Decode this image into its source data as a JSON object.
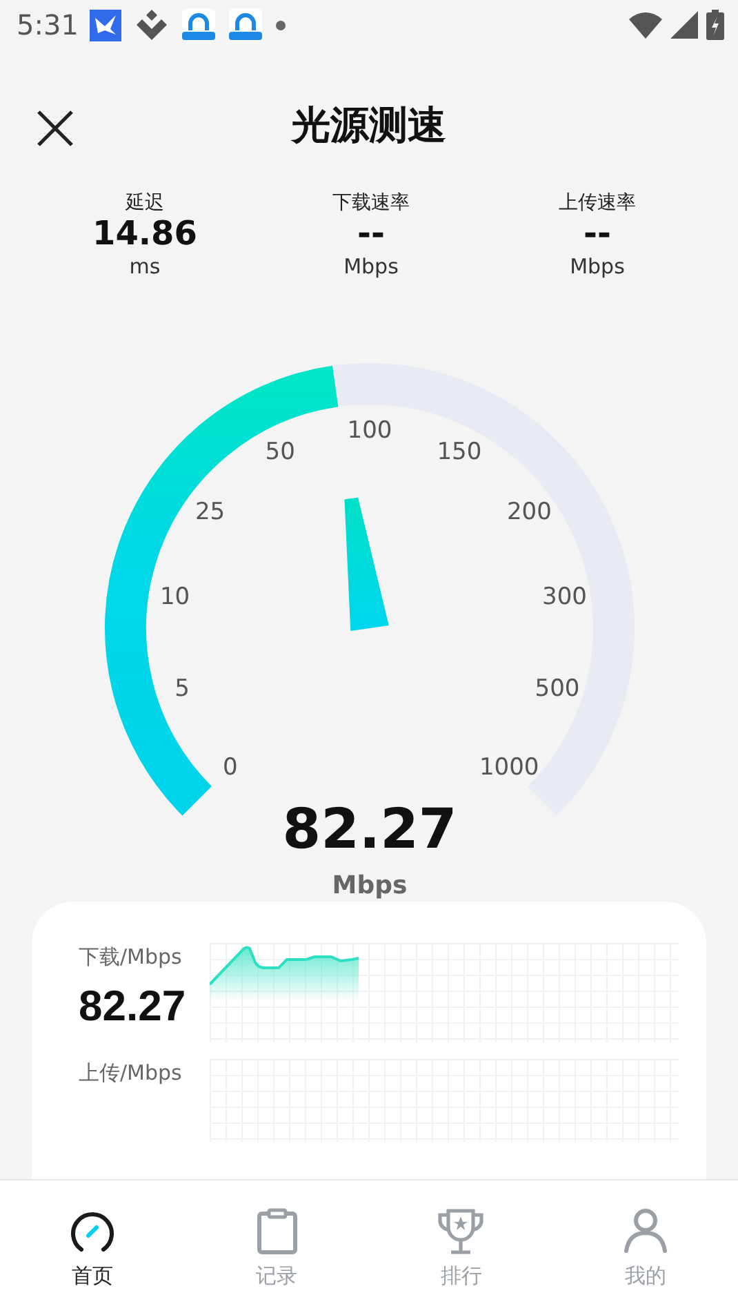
{
  "status_bar": {
    "time": "5:31"
  },
  "header": {
    "title": "光源测速"
  },
  "stats": [
    {
      "label": "延迟",
      "value": "14.86",
      "unit": "ms"
    },
    {
      "label": "下载速率",
      "value": "--",
      "unit": "Mbps"
    },
    {
      "label": "上传速率",
      "value": "--",
      "unit": "Mbps"
    }
  ],
  "gauge": {
    "scale_labels": [
      "0",
      "5",
      "10",
      "25",
      "50",
      "100",
      "150",
      "200",
      "300",
      "500",
      "1000"
    ],
    "speed": "82.27",
    "unit": "Mbps"
  },
  "speed_card": {
    "sections": [
      {
        "label": "下载/Mbps",
        "value": "82.27"
      },
      {
        "label": "上传/Mbps"
      }
    ]
  },
  "nav": [
    {
      "label": "首页",
      "selected": true
    },
    {
      "label": "记录",
      "selected": false
    },
    {
      "label": "排行",
      "selected": false
    },
    {
      "label": "我的",
      "selected": false
    }
  ]
}
